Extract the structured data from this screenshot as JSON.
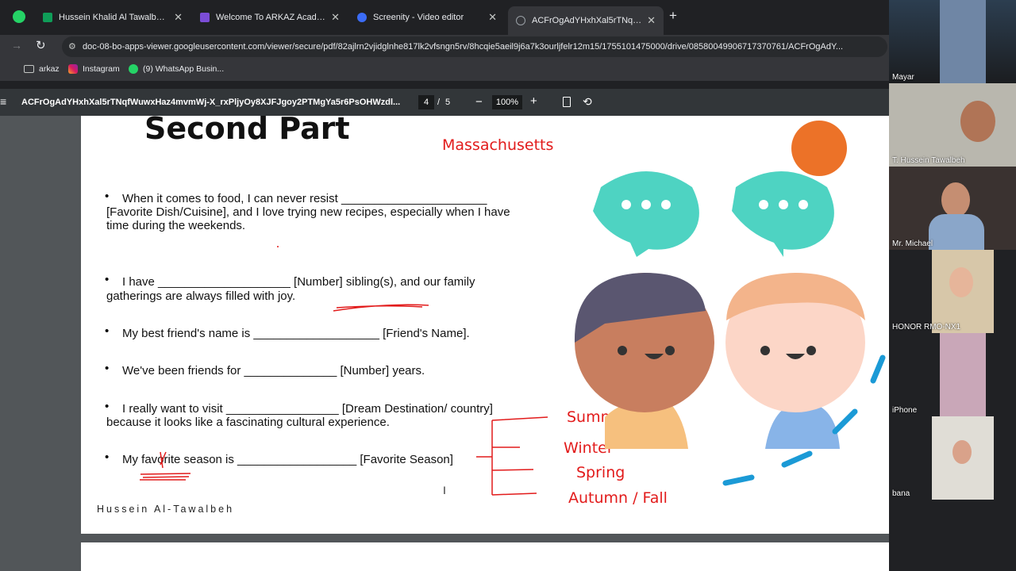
{
  "browser": {
    "tabs": [
      {
        "title": "Hussein Khalid Al Tawalbeh - G",
        "icon": "sheets-icon",
        "color": "#0f9d58"
      },
      {
        "title": "Welcome To ARKAZ Academy",
        "icon": "forms-icon",
        "color": "#7b4dd6"
      },
      {
        "title": "Screenity - Video editor",
        "icon": "screenity-icon",
        "color": "#3b6cf6"
      },
      {
        "title": "ACFrOgAdYHxhXal5rTNqfWuwx",
        "icon": "globe-icon",
        "color": "#9aa0a6"
      }
    ],
    "url": "doc-08-bo-apps-viewer.googleusercontent.com/viewer/secure/pdf/82ajlrn2vjidglnhe817lk2vfsngn5rv/8hcqie5aeil9j6a7k3ourljfelr12m15/1755101475000/drive/08580049906717370761/ACFrOgAdY...",
    "bookmarks": [
      {
        "label": "arkaz",
        "icon": "folder-icon"
      },
      {
        "label": "Instagram",
        "icon": "instagram-icon"
      },
      {
        "label": "(9) WhatsApp Busin...",
        "icon": "whatsapp-icon"
      }
    ]
  },
  "pdf": {
    "filename": "ACFrOgAdYHxhXal5rTNqfWuwxHaz4mvmWj-X_rxPljyOy8XJFJgoy2PTMgYa5r6PsOHWzdl...",
    "page_current": "4",
    "page_sep": "/",
    "page_total": "5",
    "zoom": "100%"
  },
  "slide": {
    "title": "Second Part",
    "lines": [
      "When it comes to food, I can never resist ______________________",
      "[Favorite Dish/Cuisine], and I love trying new recipes, especially when I have",
      "time during the weekends.",
      "I have ____________________ [Number] sibling(s), and our family",
      "gatherings are always filled with joy.",
      "My best friend's name is ___________________ [Friend's Name].",
      "We've been friends for ______________ [Number] years.",
      "I really want to visit _________________ [Dream Destination/ country]",
      "because it looks like a fascinating cultural experience.",
      "My favorite season is __________________ [Favorite Season]"
    ],
    "footer": "Hussein Al-Tawalbeh",
    "annotations": [
      "Massachusetts",
      "Summer",
      "Winter",
      "Spring",
      "Autumn / Fall"
    ]
  },
  "participants": [
    "Mayar",
    "T. Hussein Tawalbeh",
    "Mr. Michael",
    "HONOR RMO-NX1",
    "iPhone",
    "bana"
  ]
}
